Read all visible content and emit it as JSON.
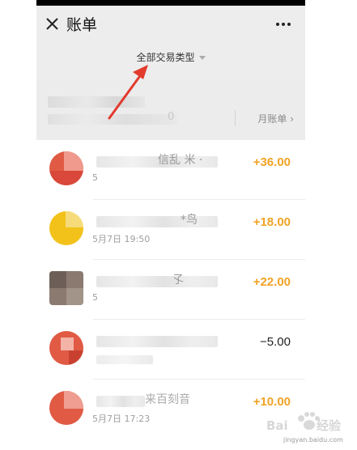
{
  "header": {
    "title": "账单",
    "close_icon": "close-icon",
    "more_icon": "more-horizontal-icon"
  },
  "filter": {
    "label": "全部交易类型",
    "caret_icon": "caret-down-icon"
  },
  "month_header": {
    "subtitle_visible_end": "0",
    "monthly_bill_label": "月账单",
    "chevron": "›"
  },
  "transactions": [
    {
      "name": "信乱   米   ·",
      "date": "5",
      "amount": "+36.00",
      "direction": "in",
      "avatar_color": "#e05a44"
    },
    {
      "name": "*鸟",
      "date": "5月7日 19:50",
      "amount": "+18.00",
      "direction": "in",
      "avatar_color": "#f2c21a"
    },
    {
      "name": "孓",
      "date": "5",
      "amount": "+22.00",
      "direction": "in",
      "avatar_color": "#8b7a70"
    },
    {
      "name": "",
      "date": "",
      "amount": "−5.00",
      "direction": "out",
      "avatar_color": "#e05a44"
    },
    {
      "name": "来百刻音",
      "date": "5月7日 17:23",
      "amount": "+10.00",
      "direction": "in",
      "avatar_color": "#e05a44"
    }
  ],
  "colors": {
    "income": "#f1a326",
    "expense": "#222222",
    "arrow": "#e23b2e"
  },
  "watermark": {
    "brand": "Bai du 经验",
    "url": "jingyan.baidu.com"
  }
}
